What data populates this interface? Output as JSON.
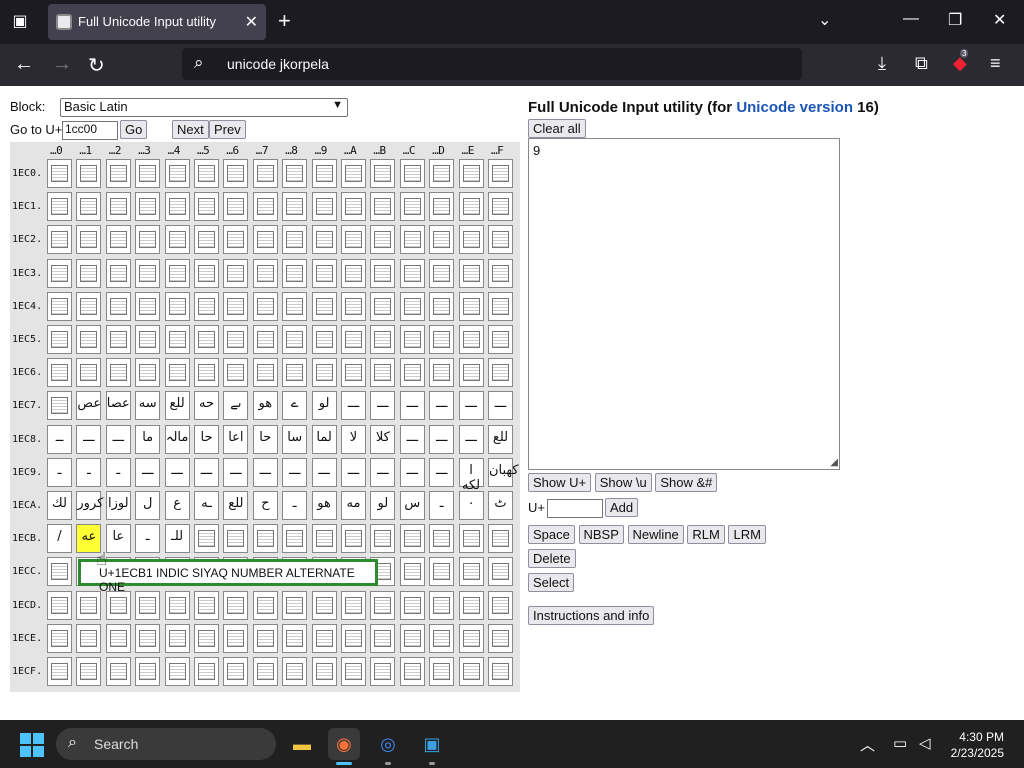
{
  "browser": {
    "tab_title": "Full Unicode Input utility",
    "address_text": "unicode jkorpela",
    "extension_badge": "3"
  },
  "page": {
    "block_label": "Block:",
    "block_value": "Basic Latin",
    "goto_label": "Go to U+",
    "goto_value": "1cc00",
    "go_button": "Go",
    "next_button": "Next",
    "prev_button": "Prev",
    "column_headers": [
      "…0",
      "…1",
      "…2",
      "…3",
      "…4",
      "…5",
      "…6",
      "…7",
      "…8",
      "…9",
      "…A",
      "…B",
      "…C",
      "…D",
      "…E",
      "…F"
    ],
    "row_headers": [
      "1EC0.",
      "1EC1.",
      "1EC2.",
      "1EC3.",
      "1EC4.",
      "1EC5.",
      "1EC6.",
      "1EC7.",
      "1EC8.",
      "1EC9.",
      "1ECA.",
      "1ECB.",
      "1ECC.",
      "1ECD.",
      "1ECE.",
      "1ECF."
    ],
    "glyph_rows": {
      "7": [
        "",
        "عص",
        "عصا",
        "سه",
        "للع",
        "حه",
        "ىے",
        "هو",
        "ے",
        "لو",
        "ـــ",
        "ـــ",
        "ـــ",
        "ـــ",
        "ـــ",
        "ـــ"
      ],
      "8": [
        "ــ",
        "ـــ",
        "ـــ",
        "ما",
        "مالہ",
        "حا",
        "اعا",
        "حا",
        "سا",
        "لما",
        "لا",
        "كلا",
        "ـــ",
        "ـــ",
        "ـــ",
        "للع"
      ],
      "9": [
        "ـ",
        "ـ",
        "ـ",
        "ـــ",
        "ـــ",
        "ـــ",
        "ـــ",
        "ـــ",
        "ـــ",
        "ـــ",
        "ـــ",
        "ـــ",
        "ـــ",
        "ـــ",
        "ا لكه",
        "كهبان"
      ],
      "10": [
        "لك",
        "كرور",
        "لوزا",
        "ل",
        "ع",
        "ـه",
        "للع",
        "ح",
        "ـ",
        "هو",
        "مه",
        "لو",
        "س",
        "ـ",
        "٠",
        "ٹ"
      ],
      "11": [
        "/",
        "عه",
        "عا",
        "ـ",
        "للـ",
        "",
        "",
        "",
        "",
        "",
        "",
        "",
        "",
        "",
        "",
        ""
      ]
    },
    "tooltip": "U+1ECB1 INDIC SIYAQ NUMBER ALTERNATE ONE",
    "title_prefix": "Full Unicode Input utility (for ",
    "title_link": "Unicode version",
    "title_suffix": " 16)",
    "clear_button": "Clear all",
    "text_content": "9",
    "show_u_button": "Show U+",
    "show_backslash_button": "Show \\u",
    "show_amp_button": "Show &#",
    "uplus_label": "U+",
    "add_button": "Add",
    "space_button": "Space",
    "nbsp_button": "NBSP",
    "newline_button": "Newline",
    "rlm_button": "RLM",
    "lrm_button": "LRM",
    "delete_button": "Delete",
    "select_button": "Select",
    "instructions_button": "Instructions and info"
  },
  "taskbar": {
    "search_text": "Search",
    "time": "4:30 PM",
    "date": "2/23/2025"
  }
}
